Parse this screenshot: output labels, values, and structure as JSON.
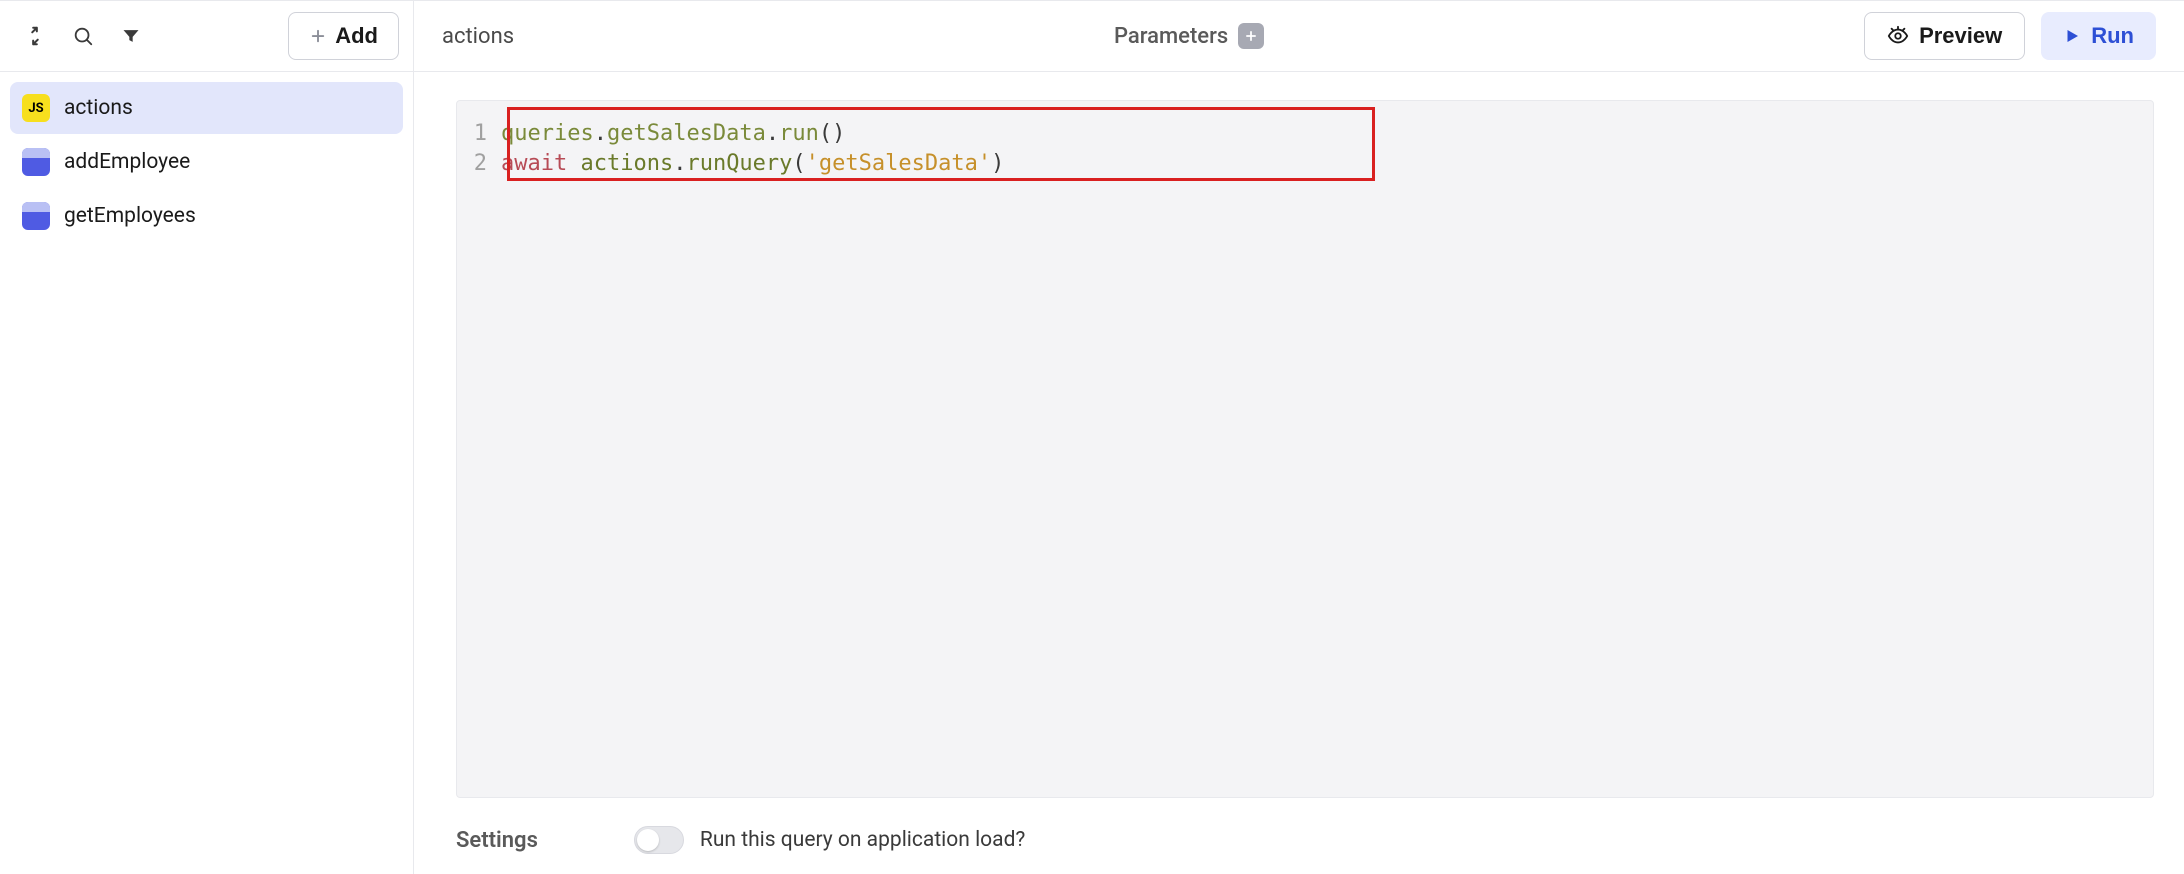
{
  "sidebar": {
    "add_label": "Add",
    "items": [
      {
        "icon": "js",
        "label": "actions",
        "active": true
      },
      {
        "icon": "db",
        "label": "addEmployee",
        "active": false
      },
      {
        "icon": "db",
        "label": "getEmployees",
        "active": false
      }
    ]
  },
  "header": {
    "title": "actions",
    "parameters_label": "Parameters",
    "preview_label": "Preview",
    "run_label": "Run"
  },
  "code": {
    "lines": [
      {
        "num": "1",
        "tokens": [
          {
            "t": "queries",
            "cls": "tok-ident"
          },
          {
            "t": ".",
            "cls": "tok-dot"
          },
          {
            "t": "getSalesData",
            "cls": "tok-ident"
          },
          {
            "t": ".",
            "cls": "tok-dot"
          },
          {
            "t": "run",
            "cls": "tok-ident"
          },
          {
            "t": "()",
            "cls": "tok-paren"
          }
        ]
      },
      {
        "num": "2",
        "tokens": [
          {
            "t": "await",
            "cls": "tok-kw"
          },
          {
            "t": " ",
            "cls": ""
          },
          {
            "t": "actions",
            "cls": "tok-ident2"
          },
          {
            "t": ".",
            "cls": "tok-dot"
          },
          {
            "t": "runQuery",
            "cls": "tok-ident2"
          },
          {
            "t": "(",
            "cls": "tok-paren"
          },
          {
            "t": "'getSalesData'",
            "cls": "tok-str"
          },
          {
            "t": ")",
            "cls": "tok-paren"
          }
        ]
      }
    ]
  },
  "settings": {
    "label": "Settings",
    "toggle_label": "Run this query on application load?",
    "toggle_on": false
  }
}
